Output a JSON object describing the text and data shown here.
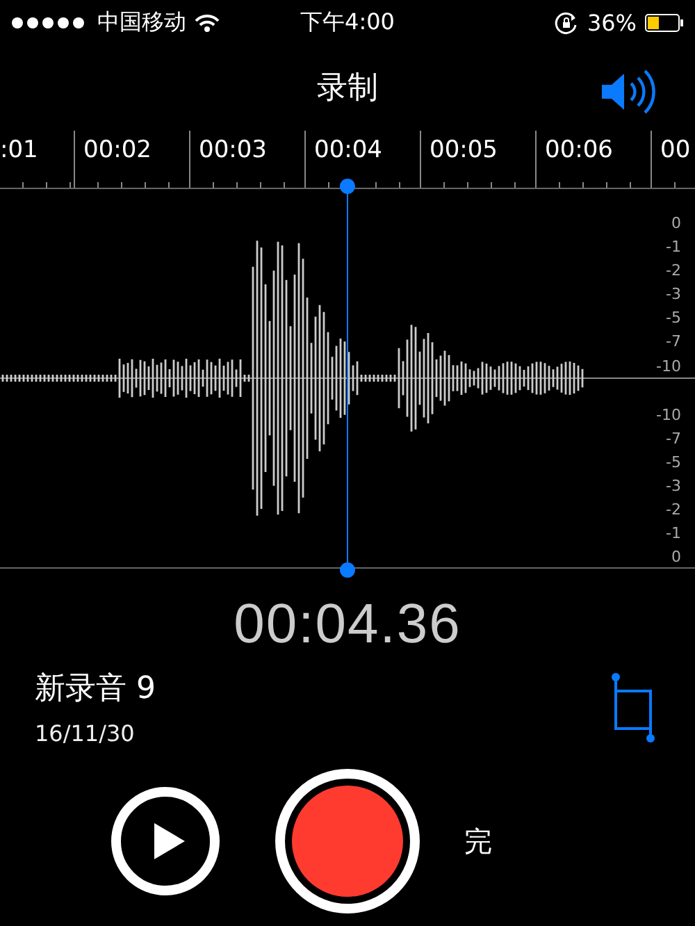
{
  "status_bar": {
    "carrier": "中国移动",
    "time": "下午4:00",
    "battery": "36%"
  },
  "title": "录制",
  "ruler": {
    "labels": [
      ":01",
      "00:02",
      "00:03",
      "00:04",
      "00:05",
      "00:06",
      "00"
    ]
  },
  "scale": {
    "upper": [
      "0",
      "-1",
      "-2",
      "-3",
      "-5",
      "-7",
      "-10"
    ],
    "lower": [
      "-10",
      "-7",
      "-5",
      "-3",
      "-2",
      "-1",
      "0"
    ]
  },
  "timer": "00:04.36",
  "recording": {
    "name": "新录音 9",
    "date": "16/11/30"
  },
  "done_button": "完"
}
